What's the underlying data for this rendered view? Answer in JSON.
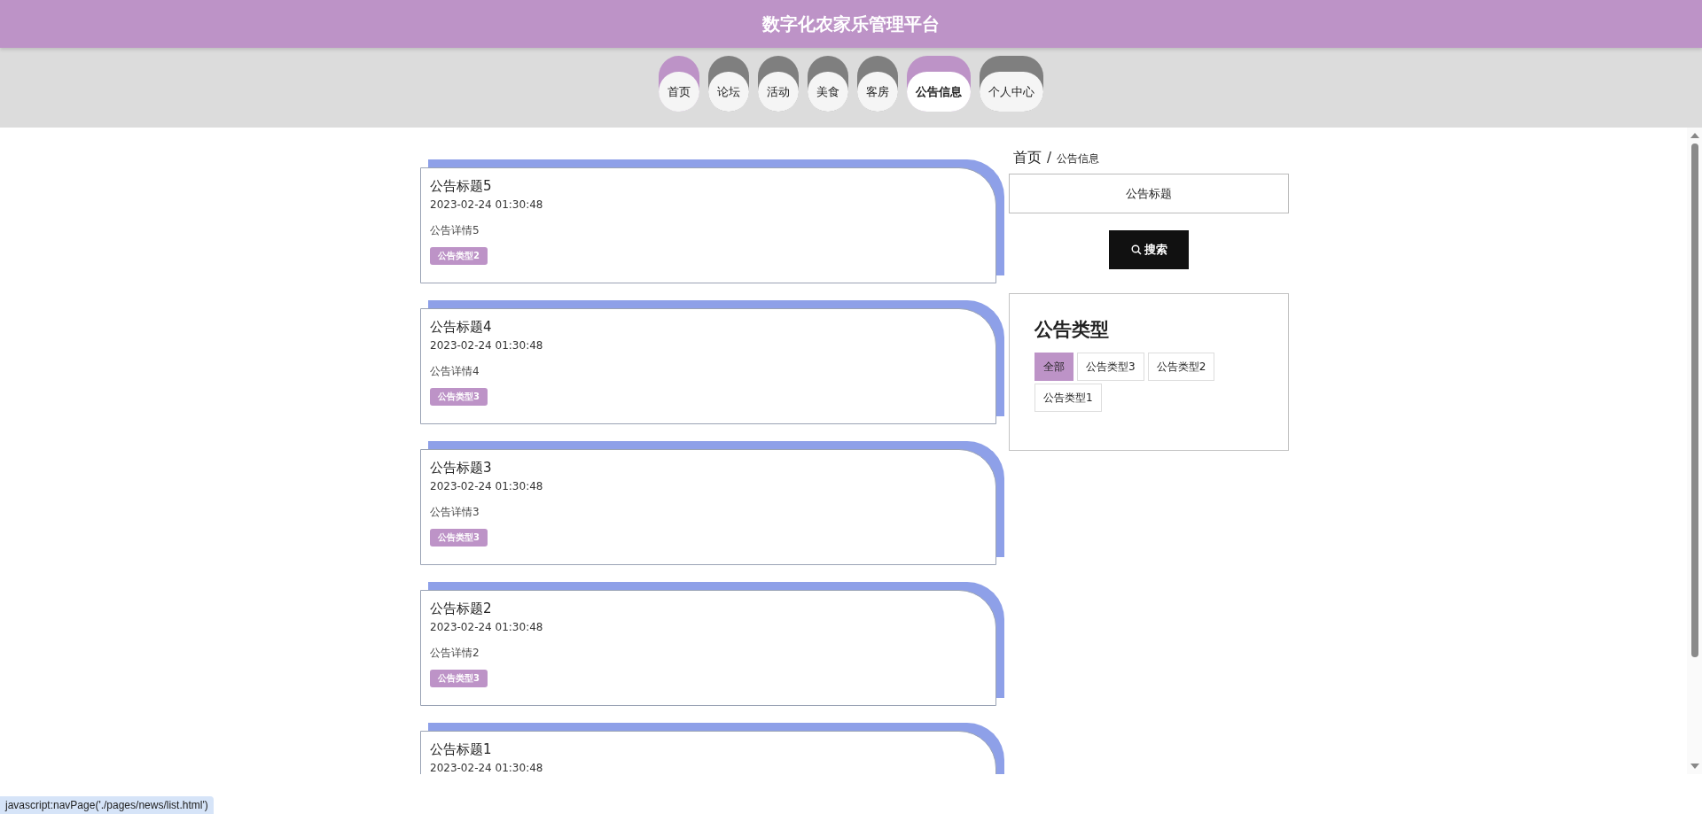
{
  "header": {
    "title": "数字化农家乐管理平台"
  },
  "nav": [
    {
      "label": "首页",
      "selected": false,
      "hovered": true
    },
    {
      "label": "论坛",
      "selected": false,
      "hovered": false
    },
    {
      "label": "活动",
      "selected": false,
      "hovered": false
    },
    {
      "label": "美食",
      "selected": false,
      "hovered": false
    },
    {
      "label": "客房",
      "selected": false,
      "hovered": false
    },
    {
      "label": "公告信息",
      "selected": true,
      "hovered": false
    },
    {
      "label": "个人中心",
      "selected": false,
      "hovered": false
    }
  ],
  "notices": [
    {
      "title": "公告标题5",
      "time": "2023-02-24 01:30:48",
      "detail": "公告详情5",
      "tag": "公告类型2"
    },
    {
      "title": "公告标题4",
      "time": "2023-02-24 01:30:48",
      "detail": "公告详情4",
      "tag": "公告类型3"
    },
    {
      "title": "公告标题3",
      "time": "2023-02-24 01:30:48",
      "detail": "公告详情3",
      "tag": "公告类型3"
    },
    {
      "title": "公告标题2",
      "time": "2023-02-24 01:30:48",
      "detail": "公告详情2",
      "tag": "公告类型3"
    },
    {
      "title": "公告标题1",
      "time": "2023-02-24 01:30:48"
    }
  ],
  "breadcrumb": {
    "home": "首页",
    "separator": "/",
    "current": "公告信息"
  },
  "search": {
    "placeholder": "公告标题",
    "button": "搜索"
  },
  "types": {
    "heading": "公告类型",
    "items": [
      {
        "label": "全部",
        "selected": true
      },
      {
        "label": "公告类型3",
        "selected": false
      },
      {
        "label": "公告类型2",
        "selected": false
      },
      {
        "label": "公告类型1",
        "selected": false
      }
    ]
  },
  "status_url": "javascript:navPage('./pages/news/list.html')"
}
